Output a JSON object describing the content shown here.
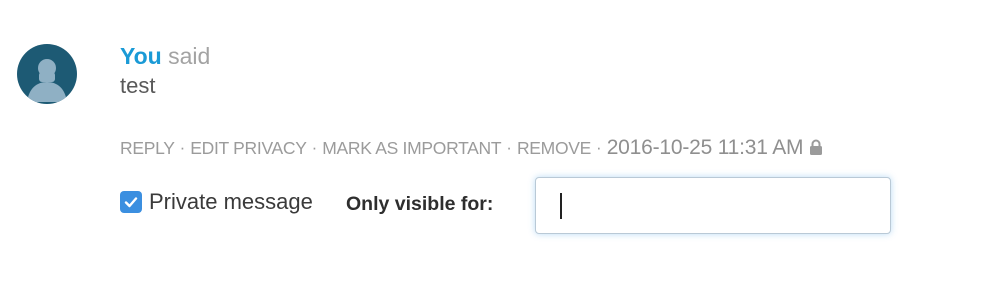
{
  "comment": {
    "author": "You",
    "said": "said",
    "body": "test",
    "actions": {
      "reply": "REPLY",
      "edit_privacy": "EDIT PRIVACY",
      "mark_important": "MARK AS IMPORTANT",
      "remove": "REMOVE",
      "separator": "·"
    },
    "timestamp": "2016-10-25 11:31 AM",
    "icons": {
      "avatar": "user-avatar-icon",
      "lock": "lock-icon",
      "checkbox": "checkmark-icon"
    }
  },
  "privacy": {
    "private_checked": true,
    "private_label": "Private message",
    "visible_for_label": "Only visible for:",
    "recipients_value": ""
  },
  "colors": {
    "author": "#1a9ad6",
    "avatar_bg": "#1d5a74",
    "checkbox": "#3b8fe0",
    "muted_text": "#9b9b9b"
  }
}
